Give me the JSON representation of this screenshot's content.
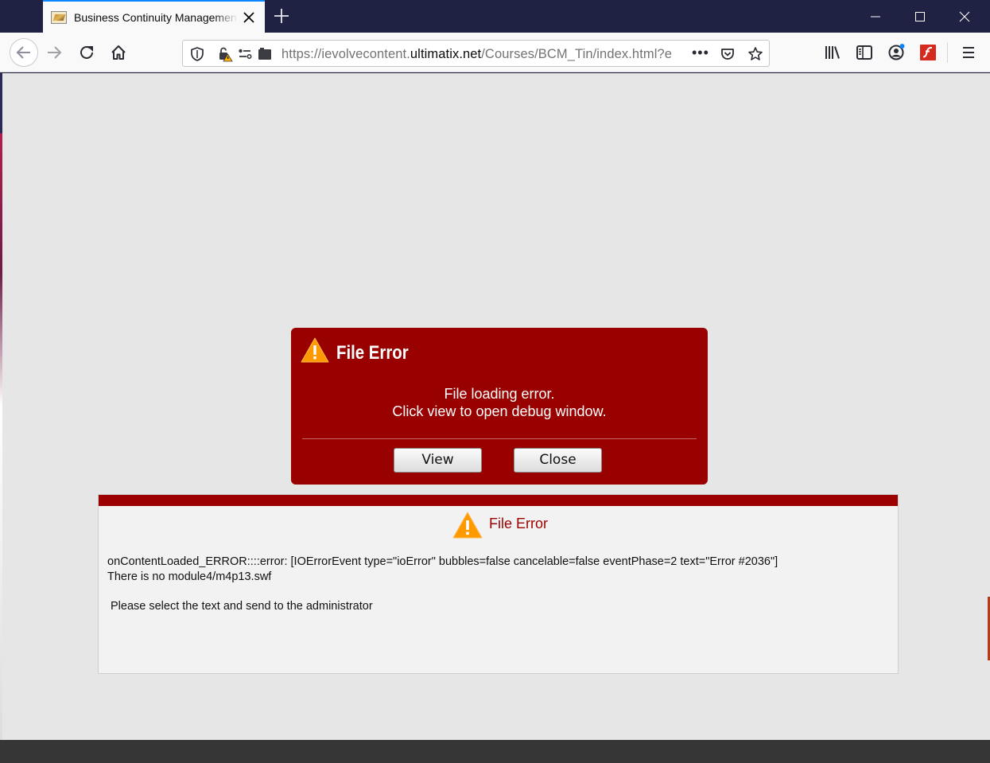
{
  "browser": {
    "tab_title": "Business Continuity Management",
    "url_prefix": "https://ievolvecontent.",
    "url_domain": "ultimatix.net",
    "url_path": "/Courses/BCM_Tin/index.html?e",
    "url_more": "•••",
    "icons": [
      "favicon",
      "close-icon",
      "plus-icon",
      "minimize-icon",
      "maximize-icon",
      "window-close-icon",
      "back-arrow-icon",
      "forward-arrow-icon",
      "reload-icon",
      "home-icon",
      "shield-icon",
      "lock-warning-icon",
      "permissions-icon",
      "reader-icon",
      "more-icon",
      "pocket-icon",
      "star-icon",
      "library-icon",
      "sidebar-icon",
      "account-icon",
      "flash-icon",
      "menu-icon"
    ]
  },
  "dialog": {
    "title": "File Error",
    "message_line1": "File loading error.",
    "message_line2": "Click view to open debug window.",
    "view_label": "View",
    "close_label": "Close",
    "background_color": "#990000"
  },
  "debug_panel": {
    "title": "File Error",
    "error_line1": "onContentLoaded_ERROR::::error: [IOErrorEvent type=\"ioError\" bubbles=false cancelable=false eventPhase=2 text=\"Error #2036\"]",
    "error_line2": "There is no module4/m4p13.swf",
    "note": "Please select the text and send to the administrator",
    "accent_color": "#9d0000"
  }
}
